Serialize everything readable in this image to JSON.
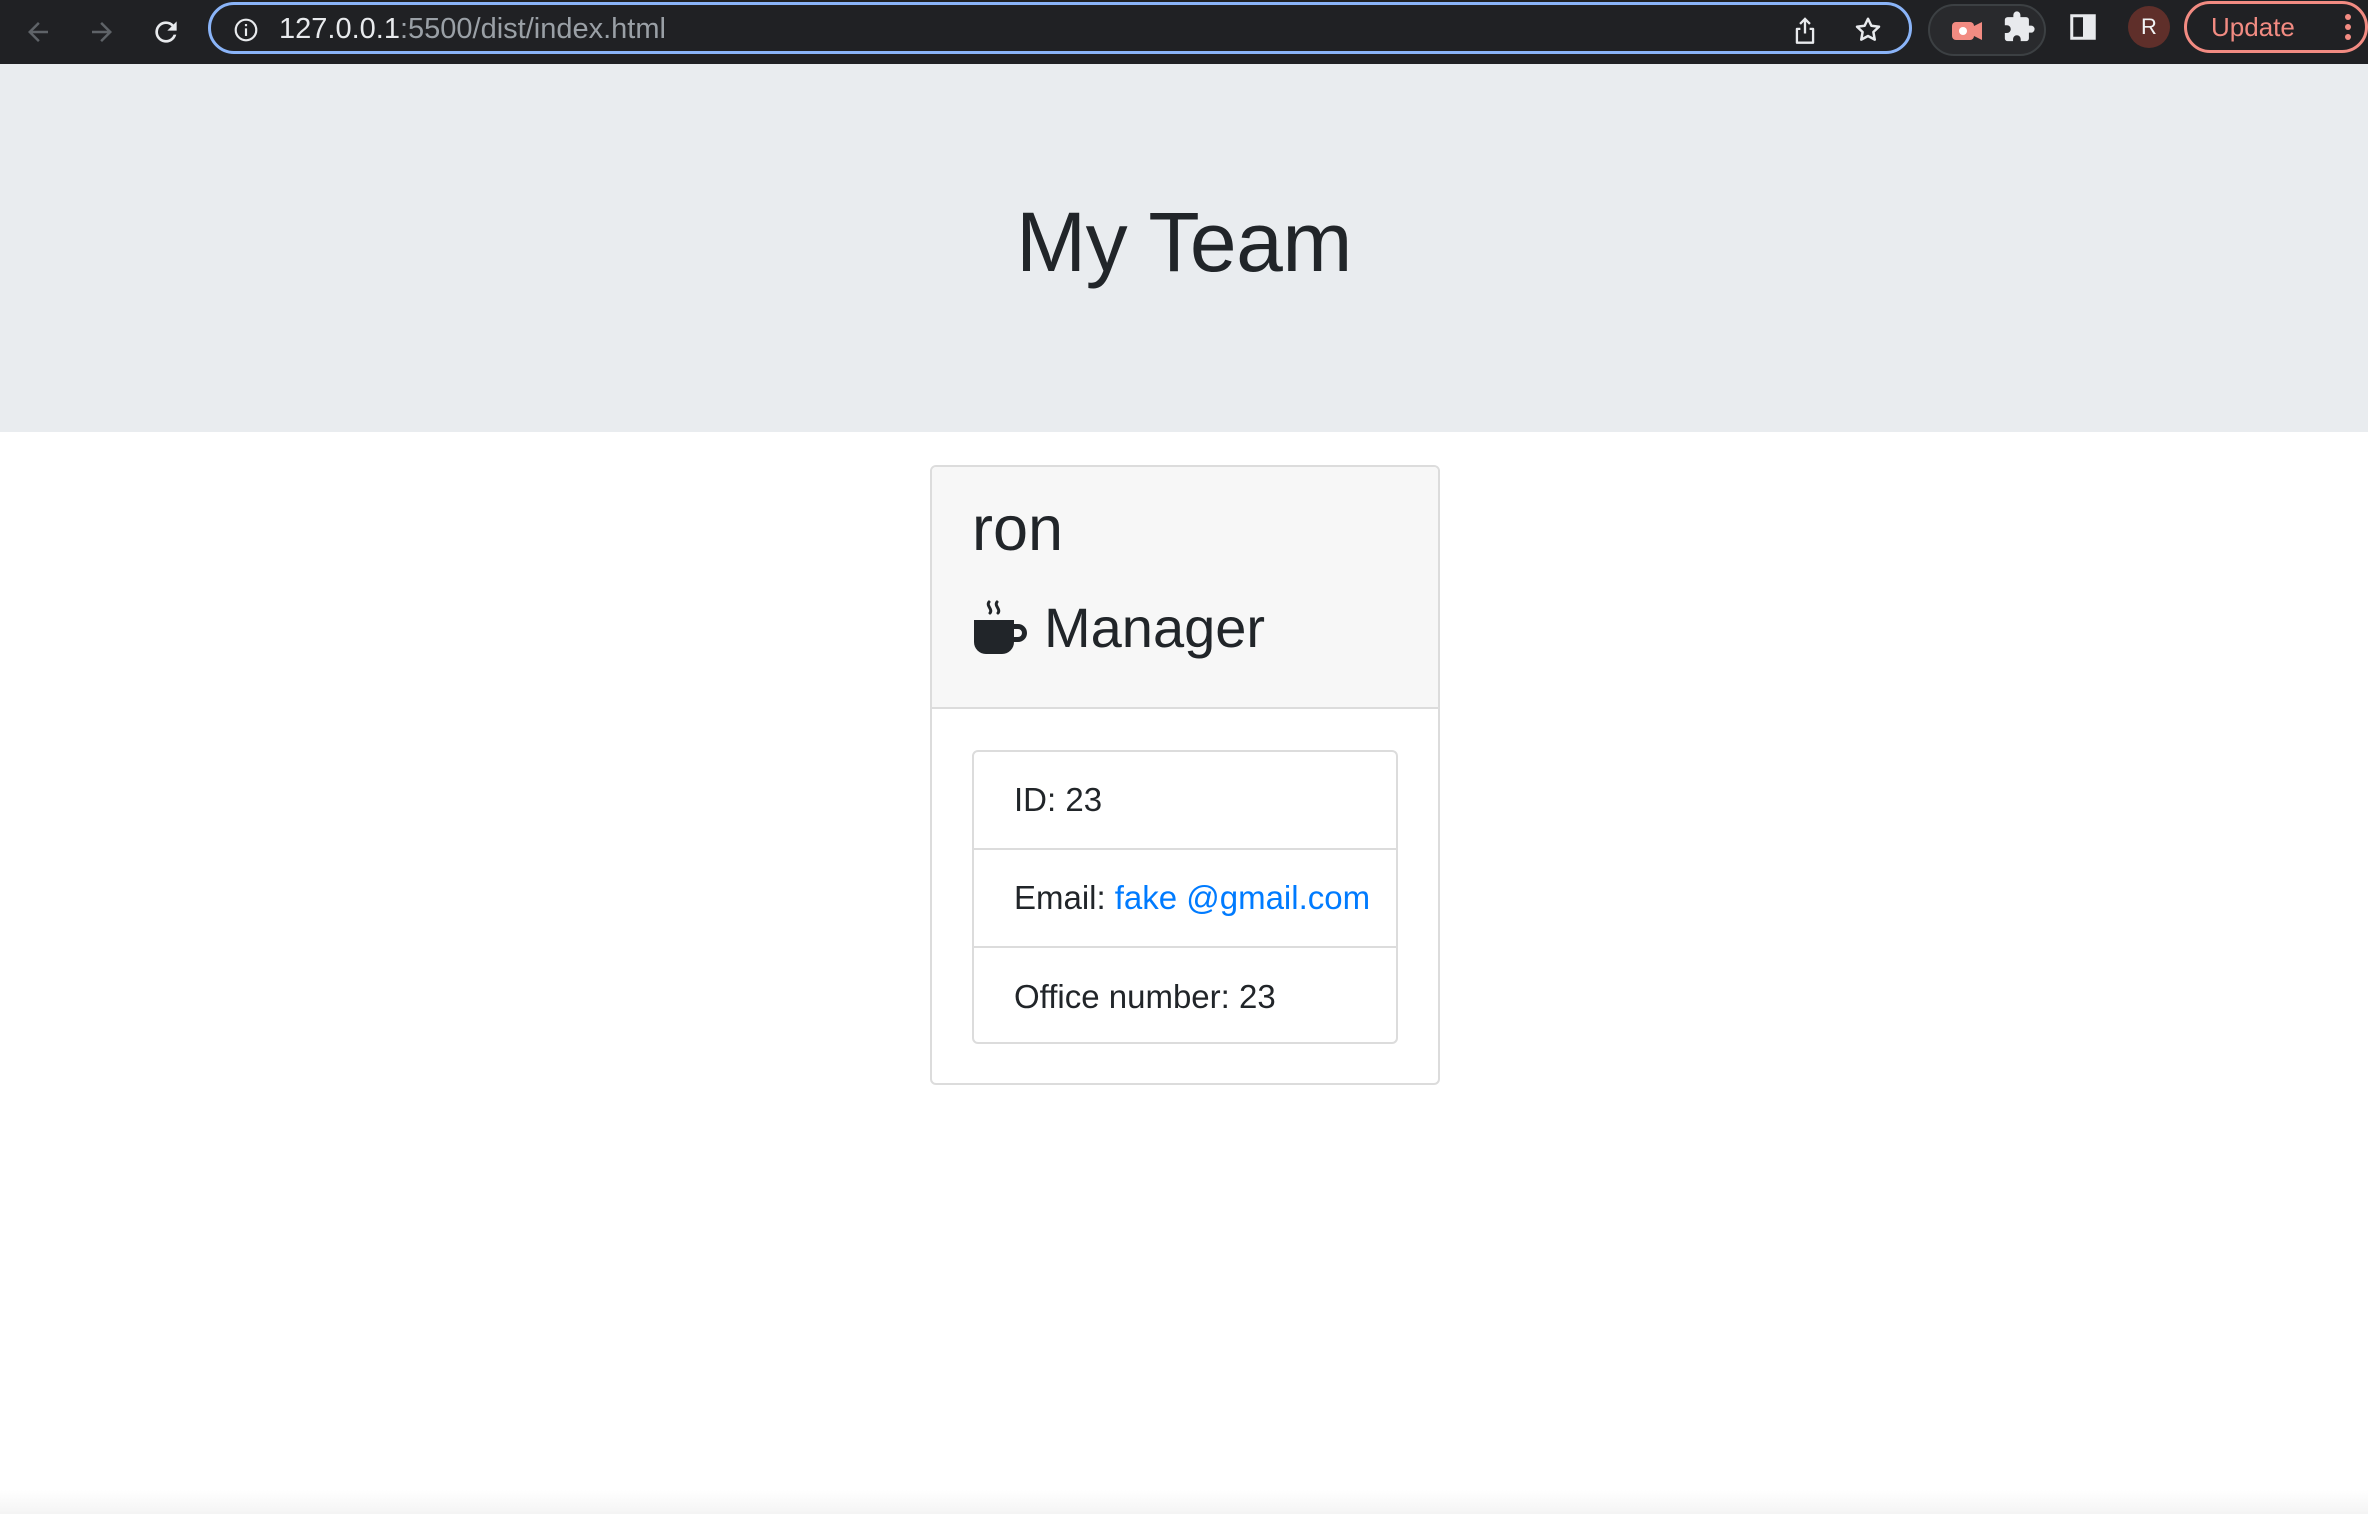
{
  "browser": {
    "url_host": "127.0.0.1",
    "url_rest": ":5500/dist/index.html",
    "avatar_initial": "R",
    "update_label": "Update",
    "icons": [
      "back-arrow-icon",
      "forward-arrow-icon",
      "reload-icon",
      "site-info-icon",
      "share-icon",
      "star-icon",
      "extension-record-icon",
      "puzzle-icon",
      "side-panel-icon",
      "kebab-menu-icon"
    ]
  },
  "header": {
    "title": "My Team"
  },
  "team": [
    {
      "name": "ron",
      "role": "Manager",
      "role_icon": "coffee-mug-icon",
      "id_label": "ID:",
      "id_value": "23",
      "email_label": "Email:",
      "email_value": "fake @gmail.com",
      "office_label": "Office number:",
      "office_value": "23"
    }
  ],
  "colors": {
    "jumbotron_bg": "#e9ecef",
    "card_header_bg": "#f7f7f7",
    "link": "#007bff",
    "text": "#212529",
    "chrome_bg": "#202124",
    "focus_ring": "#8ab4f8",
    "update_accent": "#f28b82"
  }
}
